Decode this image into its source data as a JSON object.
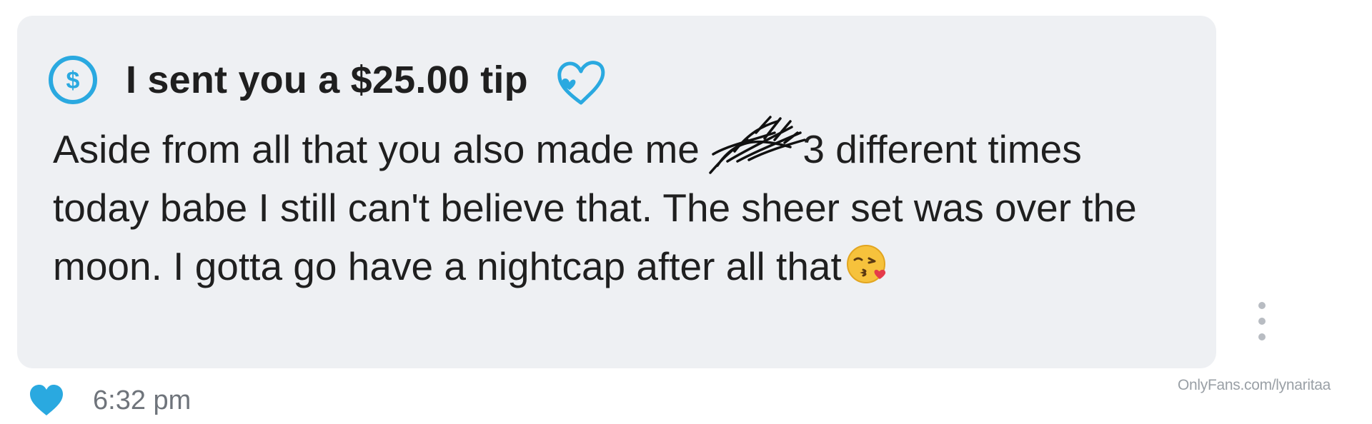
{
  "message": {
    "tip_text": "I sent you a $25.00 tip",
    "body_before_scribble": "Aside from all that you also made me ",
    "body_after_scribble": " 3 different times today babe I still can't believe that. The sheer set was over the moon. I gotta go have a nightcap after all that",
    "time": "6:32 pm"
  },
  "watermark": "OnlyFans.com/lynaritaa",
  "icons": {
    "tip": "dollar-circle-icon",
    "decoration": "heart-outline-icon",
    "emoji": "kissing-face-emoji",
    "like": "heart-filled-icon",
    "menu": "more-vertical-icon"
  },
  "colors": {
    "accent": "#2aa9e0",
    "bubble_bg": "#eef0f3",
    "text": "#1f1f1f",
    "muted": "#6f747b",
    "icon_grey": "#b8bcc2",
    "watermark": "#9aa0a6"
  }
}
